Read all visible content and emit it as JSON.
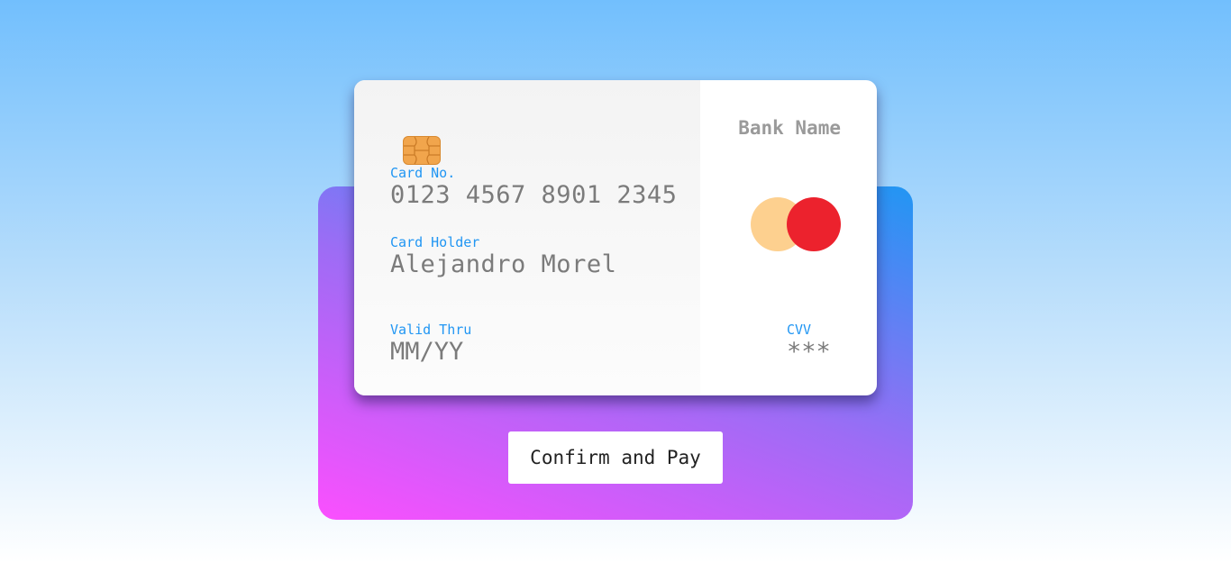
{
  "card": {
    "bank_name": "Bank Name",
    "chip_icon": "sim-chip-icon",
    "number_label": "Card No.",
    "number_value": "0123 4567 8901 2345",
    "holder_label": "Card Holder",
    "holder_value": "Alejandro Morel",
    "valid_label": "Valid Thru",
    "valid_value": "MM/YY",
    "cvv_label": "CVV",
    "cvv_value": "***",
    "network_logo": "mastercard-logo",
    "colors": {
      "label": "#2196f3",
      "value": "#7b7b7b",
      "logo_left": "#fdd08f",
      "logo_right": "#ec222d",
      "chip": "#f1a54c"
    }
  },
  "actions": {
    "confirm_label": "Confirm and Pay"
  },
  "theme": {
    "background_top": "#72bffd",
    "background_bottom": "#ffffff",
    "panel_gradient_start": "#fb4ffe",
    "panel_gradient_end": "#2196f3"
  }
}
